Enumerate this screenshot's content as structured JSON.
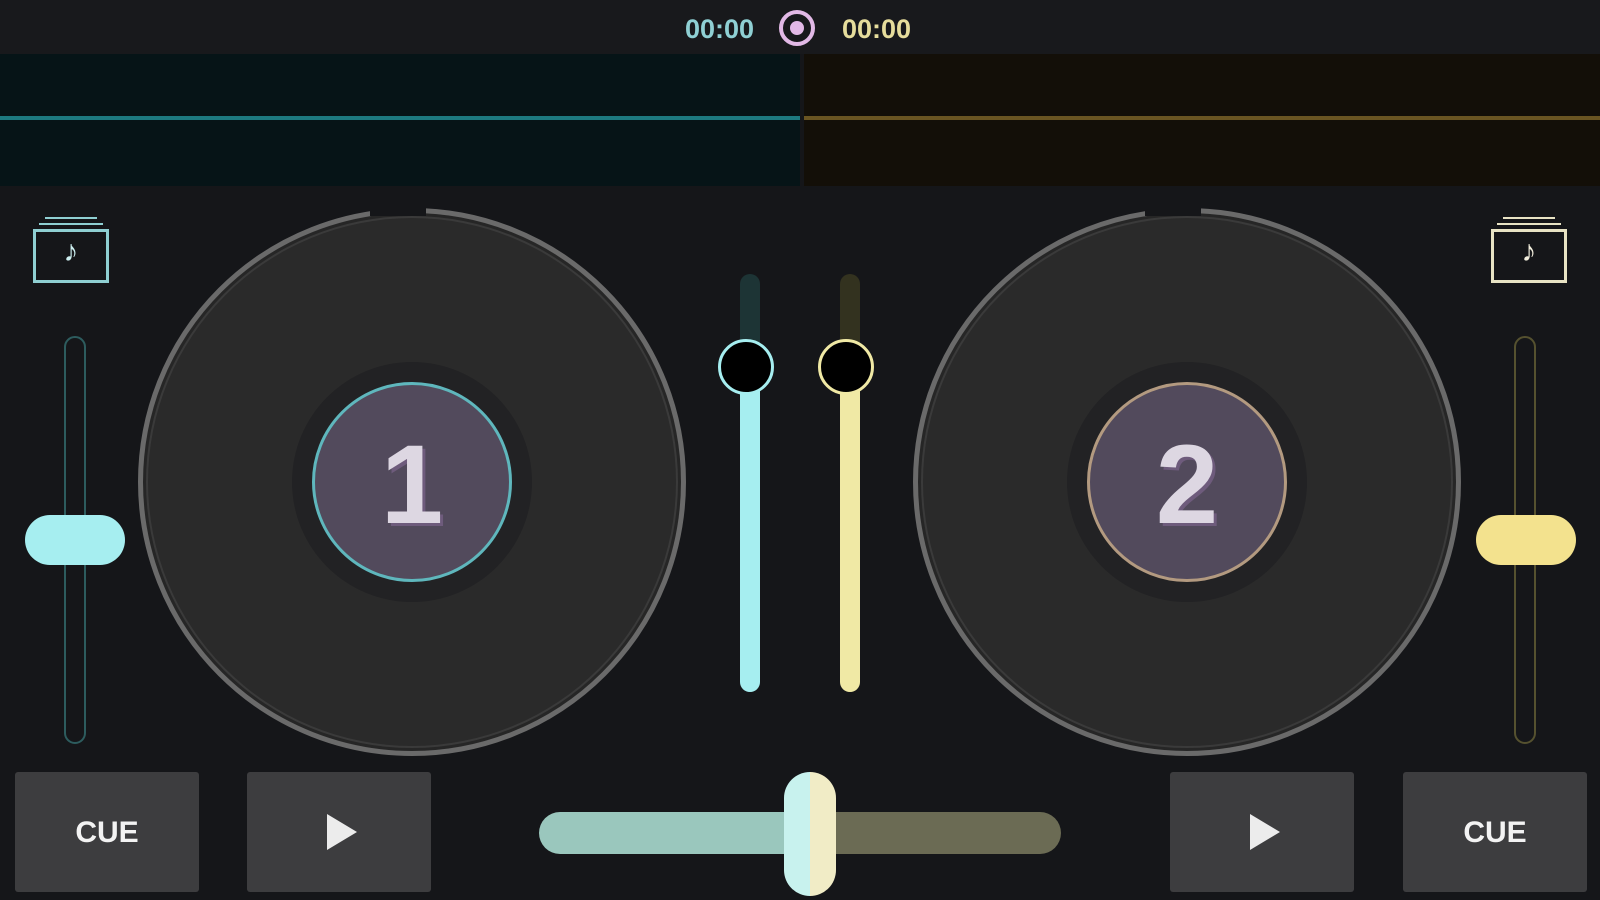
{
  "topbar": {
    "time_left": "00:00",
    "time_right": "00:00",
    "record_icon": "record-icon"
  },
  "colors": {
    "deck_a_accent": "#a6eef0",
    "deck_b_accent": "#f3e28e",
    "record": "#e2b9e6",
    "background": "#151619"
  },
  "deck_a": {
    "number": "1",
    "library_icon": "music-library-icon",
    "library_glyph": "♪",
    "cue_label": "CUE",
    "play_icon": "play-icon",
    "pitch_level": 0.5,
    "volume_level": 0.82
  },
  "deck_b": {
    "number": "2",
    "library_icon": "music-library-icon",
    "library_glyph": "♪",
    "cue_label": "CUE",
    "play_icon": "play-icon",
    "pitch_level": 0.5,
    "volume_level": 0.82
  },
  "crossfader": {
    "position": 0.52
  }
}
